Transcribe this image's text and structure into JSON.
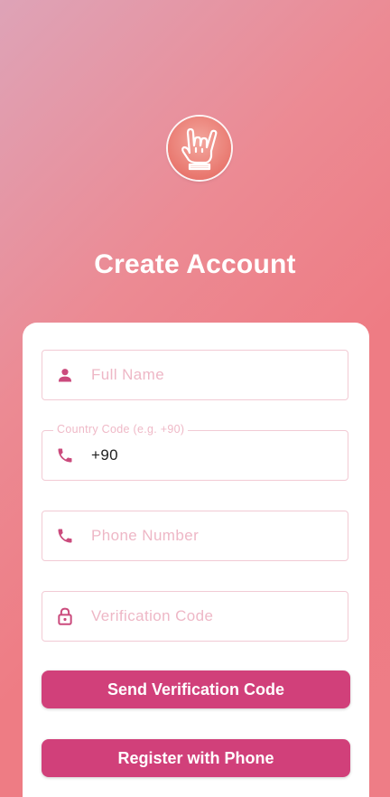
{
  "page": {
    "title": "Create Account"
  },
  "logo": {
    "icon": "rock-hand-icon"
  },
  "form": {
    "full_name": {
      "placeholder": "Full Name",
      "icon": "person-icon"
    },
    "country_code": {
      "label": "Country Code (e.g. +90)",
      "value": "+90",
      "icon": "phone-icon"
    },
    "phone_number": {
      "placeholder": "Phone Number",
      "icon": "phone-icon"
    },
    "verification_code": {
      "placeholder": "Verification Code",
      "icon": "lock-icon"
    }
  },
  "buttons": {
    "send_code": "Send Verification Code",
    "register": "Register with Phone"
  },
  "colors": {
    "accent": "#d1407a",
    "field_border": "#f2cad4",
    "placeholder": "#eeb7c6",
    "background_start": "#dea3b7",
    "background_end": "#ee7d86"
  }
}
